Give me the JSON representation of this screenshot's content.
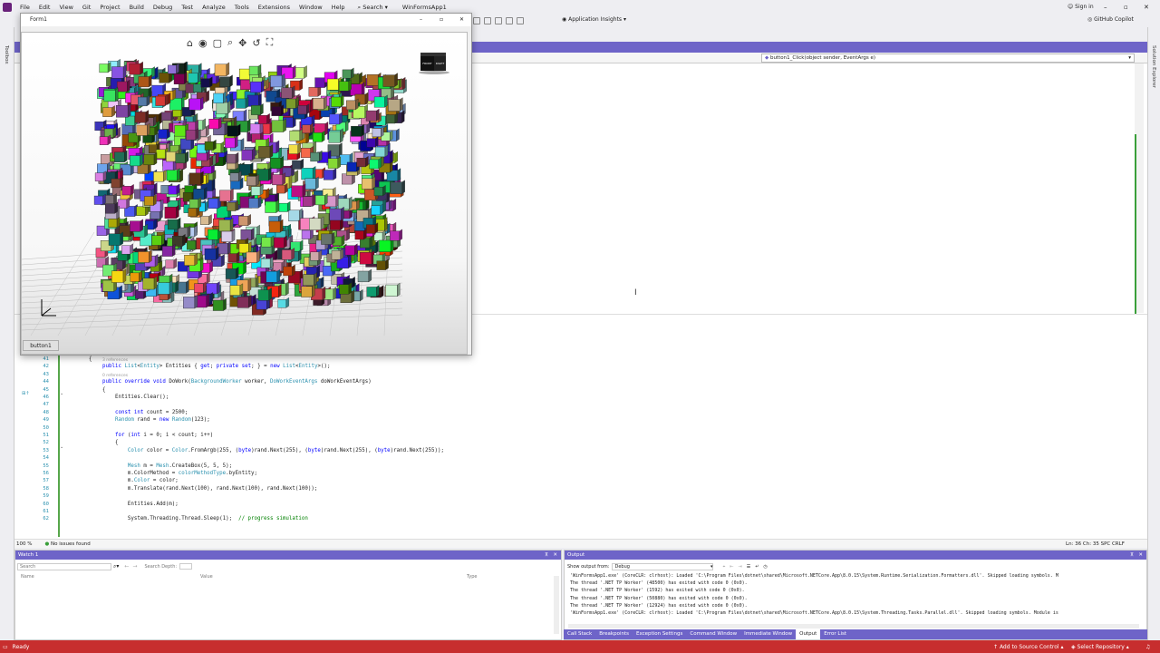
{
  "menubar": {
    "items": [
      "File",
      "Edit",
      "View",
      "Git",
      "Project",
      "Build",
      "Debug",
      "Test",
      "Analyze",
      "Tools",
      "Extensions",
      "Window",
      "Help"
    ],
    "search": "Search",
    "solution": "WinFormsApp1",
    "sign_in": "Sign in"
  },
  "toolbar": {
    "app_insights": "Application Insights",
    "copilot": "GitHub Copilot"
  },
  "sidebars": {
    "left": "Toolbox",
    "right": "Solution Explorer"
  },
  "editor": {
    "method_dropdown": "button1_Click(object sender, EventArgs e)",
    "zoom": "100 %",
    "issues": "No issues found",
    "position": "Ln: 36   Ch: 35   SPC   CRLF"
  },
  "form": {
    "title": "Form1",
    "button": "button1",
    "nav_cube_labels": [
      "FRONT",
      "RIGHT"
    ]
  },
  "code": [
    {
      "num": "41",
      "text": "{"
    },
    {
      "num": "42",
      "text": "public List<Entity> Entities { get; private set; } = new List<Entity>();",
      "hint": "3 references"
    },
    {
      "num": "43",
      "text": ""
    },
    {
      "num": "44",
      "text": "public override void DoWork(BackgroundWorker worker, DoWorkEventArgs doWorkEventArgs)",
      "hint": "0 references"
    },
    {
      "num": "45",
      "text": "{"
    },
    {
      "num": "46",
      "text": "    Entities.Clear();"
    },
    {
      "num": "47",
      "text": ""
    },
    {
      "num": "48",
      "text": "    const int count = 2500;"
    },
    {
      "num": "49",
      "text": "    Random rand = new Random(123);"
    },
    {
      "num": "50",
      "text": ""
    },
    {
      "num": "51",
      "text": "    for (int i = 0; i < count; i++)"
    },
    {
      "num": "52",
      "text": "    {"
    },
    {
      "num": "53",
      "text": "        Color color = Color.FromArgb(255, (byte)rand.Next(255), (byte)rand.Next(255), (byte)rand.Next(255));"
    },
    {
      "num": "54",
      "text": ""
    },
    {
      "num": "55",
      "text": "        Mesh m = Mesh.CreateBox(5, 5, 5);"
    },
    {
      "num": "56",
      "text": "        m.ColorMethod = colorMethodType.byEntity;"
    },
    {
      "num": "57",
      "text": "        m.Color = color;"
    },
    {
      "num": "58",
      "text": "        m.Translate(rand.Next(100), rand.Next(100), rand.Next(100));"
    },
    {
      "num": "59",
      "text": ""
    },
    {
      "num": "60",
      "text": "        Entities.Add(m);"
    },
    {
      "num": "61",
      "text": ""
    },
    {
      "num": "62",
      "text": "        System.Threading.Thread.Sleep(1);  // progress simulation"
    }
  ],
  "watch": {
    "title": "Watch 1",
    "search_placeholder": "Search",
    "search_depth": "Search Depth:",
    "columns": [
      "Name",
      "Value",
      "Type"
    ]
  },
  "output": {
    "title": "Output",
    "show_from_label": "Show output from:",
    "source": "Debug",
    "lines": [
      "'WinFormsApp1.exe' (CoreCLR: clrhost): Loaded 'C:\\Program Files\\dotnet\\shared\\Microsoft.NETCore.App\\8.0.15\\System.Runtime.Serialization.Formatters.dll'. Skipped loading symbols. M",
      "The thread '.NET TP Worker' (48500) has exited with code 0 (0x0).",
      "The thread '.NET TP Worker' (1592) has exited with code 0 (0x0).",
      "The thread '.NET TP Worker' (50880) has exited with code 0 (0x0).",
      "The thread '.NET TP Worker' (12924) has exited with code 0 (0x0).",
      "'WinFormsApp1.exe' (CoreCLR: clrhost): Loaded 'C:\\Program Files\\dotnet\\shared\\Microsoft.NETCore.App\\8.0.15\\System.Threading.Tasks.Parallel.dll'. Skipped loading symbols. Module is"
    ],
    "tabs": [
      "Call Stack",
      "Breakpoints",
      "Exception Settings",
      "Command Window",
      "Immediate Window",
      "Output",
      "Error List"
    ],
    "active_tab": "Output"
  },
  "statusbar": {
    "left": "Ready",
    "source_control": "Add to Source Control",
    "repository": "Select Repository"
  },
  "colors": {
    "accent": "#6e64c8",
    "status_bar": "#c72e2e",
    "change_bar": "#57a64a"
  }
}
